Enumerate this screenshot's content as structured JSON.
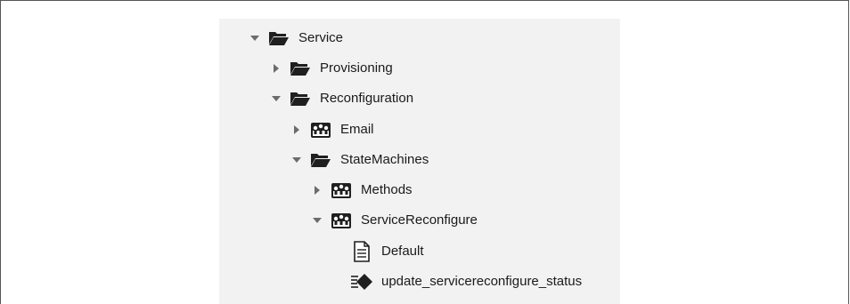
{
  "tree": {
    "items": [
      {
        "label": "Service",
        "icon": "folder-open-icon",
        "expander": "expanded"
      },
      {
        "label": "Provisioning",
        "icon": "folder-open-icon",
        "expander": "collapsed"
      },
      {
        "label": "Reconfiguration",
        "icon": "folder-open-icon",
        "expander": "expanded"
      },
      {
        "label": "Email",
        "icon": "class-icon",
        "expander": "collapsed"
      },
      {
        "label": "StateMachines",
        "icon": "folder-open-icon",
        "expander": "expanded"
      },
      {
        "label": "Methods",
        "icon": "class-icon",
        "expander": "collapsed"
      },
      {
        "label": "ServiceReconfigure",
        "icon": "class-icon",
        "expander": "expanded"
      },
      {
        "label": "Default",
        "icon": "document-icon",
        "expander": "none"
      },
      {
        "label": "update_servicereconfigure_status",
        "icon": "method-icon",
        "expander": "none"
      }
    ]
  },
  "colors": {
    "panel_background": "#f2f2f2",
    "icon_dark": "#1f1f1f",
    "expander": "#6b6b6b"
  }
}
